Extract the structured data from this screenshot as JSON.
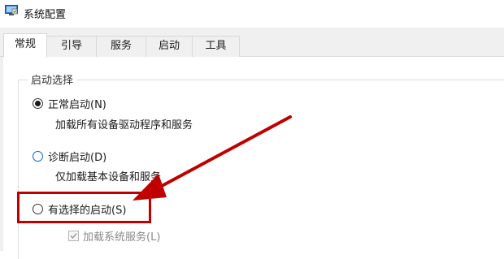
{
  "window": {
    "title": "系统配置",
    "icon": "system-config-icon"
  },
  "tabs": [
    {
      "label": "常规",
      "active": true
    },
    {
      "label": "引导",
      "active": false
    },
    {
      "label": "服务",
      "active": false
    },
    {
      "label": "启动",
      "active": false
    },
    {
      "label": "工具",
      "active": false
    }
  ],
  "startup_selection": {
    "group_label": "启动选择",
    "options": [
      {
        "label": "正常启动(N)",
        "description": "加载所有设备驱动程序和服务",
        "selected": true
      },
      {
        "label": "诊断启动(D)",
        "description": "仅加载基本设备和服务",
        "selected": false
      },
      {
        "label": "有选择的启动(S)",
        "selected": false
      }
    ],
    "sub_options": [
      {
        "label": "加载系统服务(L)",
        "checked": true,
        "enabled": false
      }
    ]
  },
  "annotation": {
    "color": "#c00000",
    "highlighted_option": "有选择的启动(S)"
  }
}
